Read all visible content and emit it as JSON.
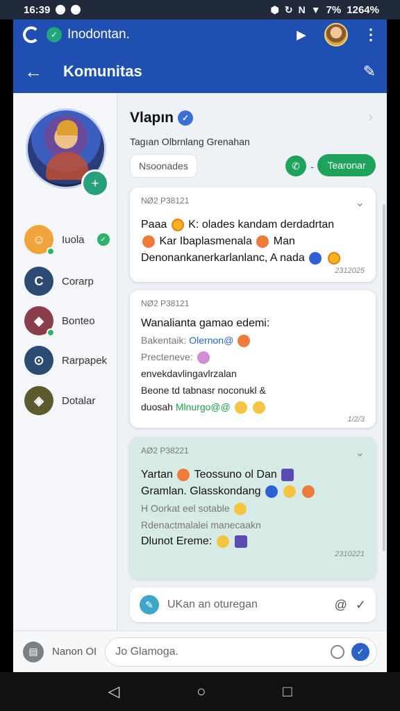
{
  "status": {
    "time": "16:39",
    "battery": "1264%",
    "signal_pct": "7%"
  },
  "topbar": {
    "app_name": "Inodontan."
  },
  "header": {
    "title": "Komunitas"
  },
  "sidebar": {
    "contacts": [
      {
        "name": "Iuola"
      },
      {
        "name": "Corarp"
      },
      {
        "name": "Bonteo"
      },
      {
        "name": "Rarpapek"
      },
      {
        "name": "Dotalar"
      }
    ]
  },
  "profile": {
    "name": "Vlapın",
    "subtitle": "Tagıan Olbrnlang Grenahan",
    "tag": "Nsoonades",
    "follow_label": "Tearonar"
  },
  "posts": [
    {
      "header": "NØ2 P38121",
      "lines": [
        "Paaa",
        "K: olades kandam derdadrtan",
        "Kar Ibaplasmenala",
        "Man",
        "Denonankanerkarlanlanc, A nada"
      ],
      "time": "2312025"
    },
    {
      "header": "NØ2 P38121",
      "line1": "Wanalianta gamao edemi:",
      "line2_prefix": "Bakentaik:",
      "line2_accent": "Olernon@",
      "line3": "Precteneve:",
      "line4": "envekdavlingavlrzalan",
      "line5": "Beone td tabnasr noconukl &",
      "line6_prefix": "duosah",
      "line6_accent": "Mlnurgo@@",
      "time": "1/2/3"
    },
    {
      "header": "AØ2 P38221",
      "line1": "Yartan",
      "line1b": "Teossuno ol Dan",
      "line2": "Gramlan. Glasskondang",
      "line3": "H Oorkat eel sotable",
      "line4": "Rdenactmalalei manecaakn",
      "line5": "Dlunot Ereme:",
      "time": "2310221"
    }
  ],
  "composer": {
    "placeholder": "UKan an oturegan"
  },
  "bottom": {
    "label": "Nanon OI",
    "input": "Jo Glamoga."
  }
}
